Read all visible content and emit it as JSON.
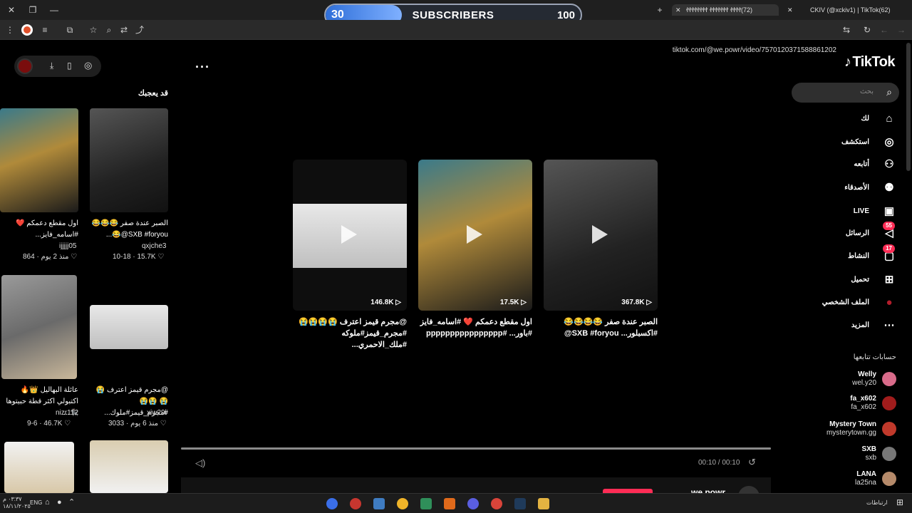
{
  "subscribers": {
    "current": "30",
    "label": "SUBSCRIBERS",
    "goal": "100",
    "progress_fraction": 0.3
  },
  "browser": {
    "tab1_title": "ꬷꬷꬷꬷꬷꬷꬷꬷ ꬷꬷꬷꬷꬷꬷꬷ ꬷꬷꬷꬷ(72)",
    "tab2_title": "CKIV (@xckiv1) | TikTok(62)",
    "url": "tiktok.com/@we.powr/video/7570120371588861202"
  },
  "tiktok": {
    "logo": "TikTok",
    "search_placeholder": "بحث",
    "nav": [
      {
        "label": "لك",
        "icon": "home-icon"
      },
      {
        "label": "استكشف",
        "icon": "compass-icon"
      },
      {
        "label": "أتابعه",
        "icon": "following-icon"
      },
      {
        "label": "الأصدقاء",
        "icon": "friends-icon"
      },
      {
        "label": "LIVE",
        "icon": "live-icon"
      },
      {
        "label": "الرسائل",
        "icon": "messages-icon",
        "badge": "55"
      },
      {
        "label": "النشاط",
        "icon": "activity-icon",
        "badge": "17"
      },
      {
        "label": "تحميل",
        "icon": "upload-icon"
      },
      {
        "label": "الملف الشخصي",
        "icon": "profile-icon"
      },
      {
        "label": "المزيد",
        "icon": "more-icon"
      }
    ],
    "following_heading": "حسابات تتابعها",
    "following": [
      {
        "name": "Welly",
        "handle": "wel.y20",
        "color": "#d86b8a"
      },
      {
        "name": "fa_x602",
        "handle": "fa_x602",
        "color": "#a11c1c"
      },
      {
        "name": "Mystery Town",
        "handle": "mysterytown.gg",
        "color": "#c0392b"
      },
      {
        "name": "SXB",
        "handle": "sxb",
        "color": "#777777"
      },
      {
        "name": "LANA",
        "handle": "la25na",
        "color": "#b58a6a"
      }
    ]
  },
  "videos": [
    {
      "views": "146.8K",
      "caption": "@مجرم قيمز اعترف 😭😭😭😭 #مجرم_قيمز#ملوكه #ملك_الاحمري..."
    },
    {
      "views": "17.5K",
      "caption": "اول مقطع دعمكم ❤️ #اسامه_فايز #باور... #pppppppppppppppp"
    },
    {
      "views": "367.8K",
      "caption": "الصبر عندة صفر 😂😂😂😂 #اكسبلور... SXB #foryou@"
    }
  ],
  "player": {
    "time": "00:10 / 00:10",
    "account": "we.powr"
  },
  "recommend": {
    "heading": "قد يعجبك",
    "items": [
      {
        "caption": "الصبر عندة صفر 😂😂😂 SXB #foryou@😂...",
        "user": "qxjche3",
        "likes": "15.7K",
        "date": "10-18"
      },
      {
        "caption": "اول مقطع دعمكم ❤️ #اسامه_فايز...",
        "user": "ijjjjj05",
        "likes": "864",
        "date": "منذ 2 يوم"
      },
      {
        "caption": "@مجرم قيمز اعترف 😭😭 😭😭#مجرم_قيمز#ملوك...",
        "user": "xiw29i",
        "likes": "3033",
        "date": "منذ 6 يوم"
      },
      {
        "caption": "عائلة البهاليل 👑🔥 اكتبولي اكثر قطة حبيتوها 🐈‍⬛...",
        "user": "nizr112",
        "likes": "46.7K",
        "date": "9-6"
      }
    ]
  },
  "taskbar": {
    "time": "٠٣:٣٧ م",
    "date": "١٨/١١/٢٠٢٥",
    "lang": "ENG",
    "network": "ارتباطات"
  }
}
